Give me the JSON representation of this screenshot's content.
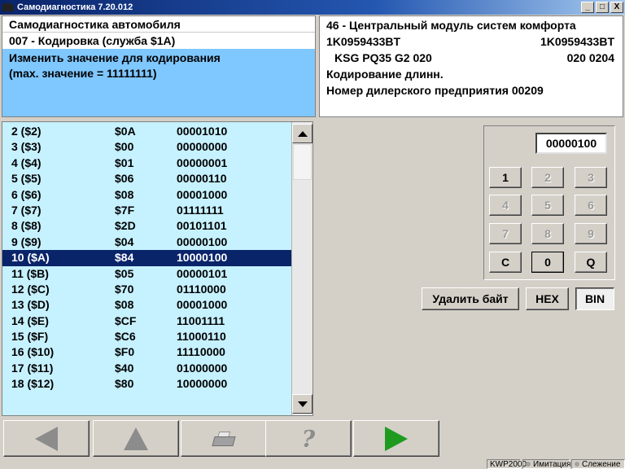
{
  "window": {
    "title": "Самодиагностика 7.20.012",
    "controls": [
      "_",
      "□",
      "X"
    ]
  },
  "left_panel": {
    "line1": "Самодиагностика автомобиля",
    "line2": "007 - Кодировка (служба $1A)",
    "instruction1": "Изменить значение для кодирования",
    "instruction2": "(max. значение = 11111111)"
  },
  "right_panel": {
    "module": "46 - Центральный модуль систем комфорта",
    "part_left": "1K0959433BT",
    "part_right": "1K0959433BT",
    "component_left": "KSG PQ35 G2  020",
    "component_right": "020  0204",
    "coding": "Кодирование длинн.",
    "dealer": "Номер дилерского предприятия 00209"
  },
  "byte_list": {
    "rows": [
      {
        "index": "2  ($2)",
        "hex": "$0A",
        "bin": "00001010"
      },
      {
        "index": "3  ($3)",
        "hex": "$00",
        "bin": "00000000"
      },
      {
        "index": "4  ($4)",
        "hex": "$01",
        "bin": "00000001"
      },
      {
        "index": "5  ($5)",
        "hex": "$06",
        "bin": "00000110"
      },
      {
        "index": "6  ($6)",
        "hex": "$08",
        "bin": "00001000"
      },
      {
        "index": "7  ($7)",
        "hex": "$7F",
        "bin": "01111111"
      },
      {
        "index": "8  ($8)",
        "hex": "$2D",
        "bin": "00101101"
      },
      {
        "index": "9  ($9)",
        "hex": "$04",
        "bin": "00000100"
      },
      {
        "index": "10  ($A)",
        "hex": "$84",
        "bin": "10000100"
      },
      {
        "index": "11  ($B)",
        "hex": "$05",
        "bin": "00000101"
      },
      {
        "index": "12  ($C)",
        "hex": "$70",
        "bin": "01110000"
      },
      {
        "index": "13  ($D)",
        "hex": "$08",
        "bin": "00001000"
      },
      {
        "index": "14  ($E)",
        "hex": "$CF",
        "bin": "11001111"
      },
      {
        "index": "15  ($F)",
        "hex": "$C6",
        "bin": "11000110"
      },
      {
        "index": "16  ($10)",
        "hex": "$F0",
        "bin": "11110000"
      },
      {
        "index": "17  ($11)",
        "hex": "$40",
        "bin": "01000000"
      },
      {
        "index": "18  ($12)",
        "hex": "$80",
        "bin": "10000000"
      }
    ],
    "selected_index": 8
  },
  "keypad": {
    "value": "00000100",
    "keys": [
      "1",
      "2",
      "3",
      "4",
      "5",
      "6",
      "7",
      "8",
      "9",
      "C",
      "0",
      "Q"
    ],
    "disabled_keys": [
      "2",
      "3",
      "4",
      "5",
      "6",
      "7",
      "8",
      "9"
    ]
  },
  "actions": {
    "delete_byte": "Удалить байт",
    "hex": "HEX",
    "bin": "BIN",
    "active_mode": "BIN"
  },
  "toolbar": {
    "icons": [
      "back-arrow-icon",
      "up-arrow-icon",
      "printer-icon",
      "help-icon",
      "forward-arrow-icon"
    ],
    "help_glyph": "?"
  },
  "statusbar": {
    "protocol": "KWP2000",
    "simulation": "Имитация",
    "tracking": "Слежение"
  },
  "colors": {
    "selection": "#0a246a",
    "list_bg": "#c6f1ff",
    "info_bg": "#7fc7ff",
    "go_green": "#1e9b1e"
  }
}
